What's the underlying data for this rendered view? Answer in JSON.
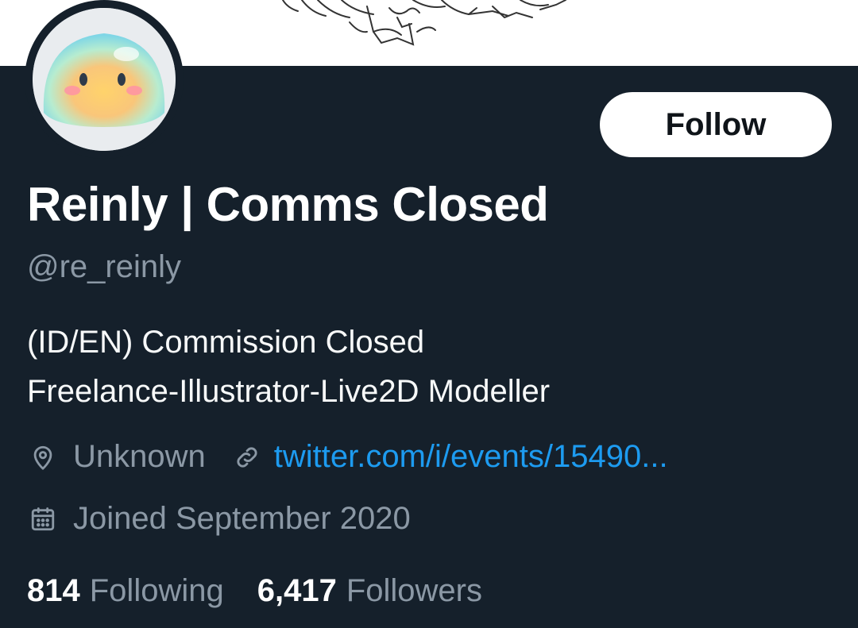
{
  "profile": {
    "display_name": "Reinly | Comms Closed",
    "handle": "@re_reinly",
    "bio_line1": "(ID/EN) Commission Closed",
    "bio_line2": "Freelance-Illustrator-Live2D Modeller",
    "location": "Unknown",
    "website": "twitter.com/i/events/15490...",
    "joined": "Joined September 2020",
    "following_count": "814",
    "following_label": "Following",
    "followers_count": "6,417",
    "followers_label": "Followers"
  },
  "actions": {
    "follow_label": "Follow"
  },
  "icons": {
    "location": "map-pin-icon",
    "website": "link-icon",
    "joined": "calendar-icon"
  },
  "colors": {
    "background": "#15202b",
    "text_primary": "#ffffff",
    "text_secondary": "#8b98a5",
    "link": "#1d9bf0",
    "follow_button_bg": "#ffffff",
    "follow_button_text": "#0f1419"
  }
}
